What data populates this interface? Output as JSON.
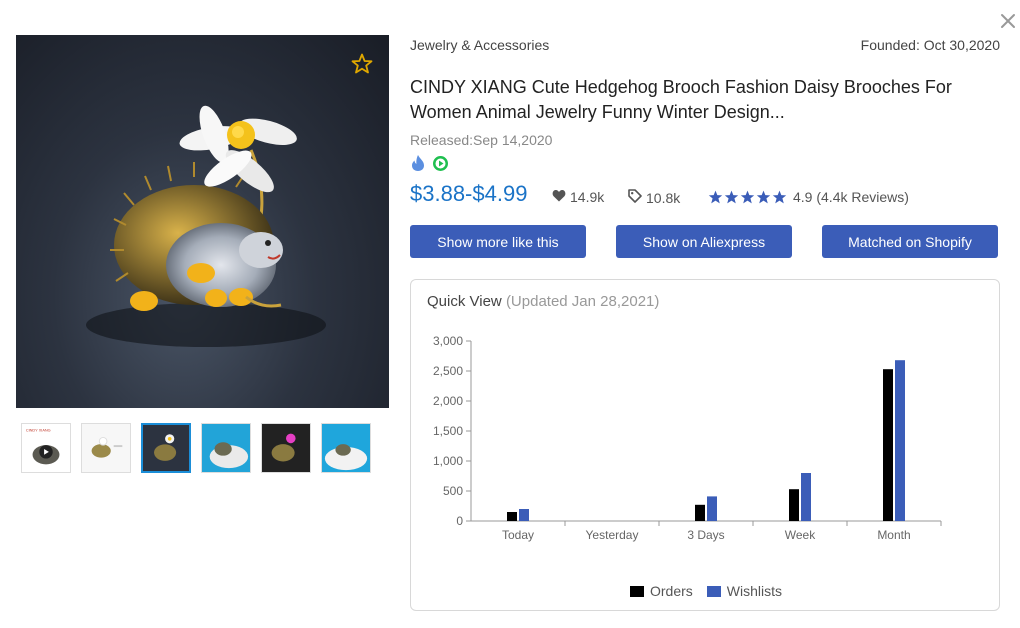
{
  "header": {
    "category": "Jewelry & Accessories",
    "founded": "Founded: Oct 30,2020"
  },
  "product": {
    "title": "CINDY XIANG Cute Hedgehog Brooch Fashion Daisy Brooches For Women Animal Jewelry Funny Winter Design...",
    "released": "Released:Sep 14,2020",
    "price": "$3.88-$4.99",
    "likes": "14.9k",
    "orders": "10.8k",
    "rating_value": 4.9,
    "rating_text": "4.9 (4.4k Reviews)",
    "badges": [
      "fire-icon",
      "play-icon"
    ],
    "badge_colors": {
      "fire": "#4a90e2",
      "play": "#22c35e"
    }
  },
  "buttons": {
    "show_more": "Show more like this",
    "show_aliexpress": "Show on Aliexpress",
    "matched_shopify": "Matched on Shopify"
  },
  "quick_view": {
    "title": "Quick View",
    "updated": "(Updated Jan 28,2021)"
  },
  "thumbnails": [
    {
      "name": "thumb-1",
      "has_play": true,
      "label": "CINDY XIANG"
    },
    {
      "name": "thumb-2"
    },
    {
      "name": "thumb-3",
      "active": true
    },
    {
      "name": "thumb-4"
    },
    {
      "name": "thumb-5"
    },
    {
      "name": "thumb-6"
    }
  ],
  "colors": {
    "accent": "#3b5db8",
    "price": "#1a73c7",
    "orders_series": "#000000",
    "wishlists_series": "#3b5db8"
  },
  "chart_data": {
    "type": "bar",
    "categories": [
      "Today",
      "Yesterday",
      "3 Days",
      "Week",
      "Month"
    ],
    "series": [
      {
        "name": "Orders",
        "values": [
          150,
          0,
          270,
          530,
          2530
        ]
      },
      {
        "name": "Wishlists",
        "values": [
          200,
          0,
          410,
          800,
          2680
        ]
      }
    ],
    "ylim": [
      0,
      3000
    ],
    "yticks": [
      "0",
      "500",
      "1,000",
      "1,500",
      "2,000",
      "2,500",
      "3,000"
    ],
    "legend": "bottom-center",
    "grid": false
  }
}
